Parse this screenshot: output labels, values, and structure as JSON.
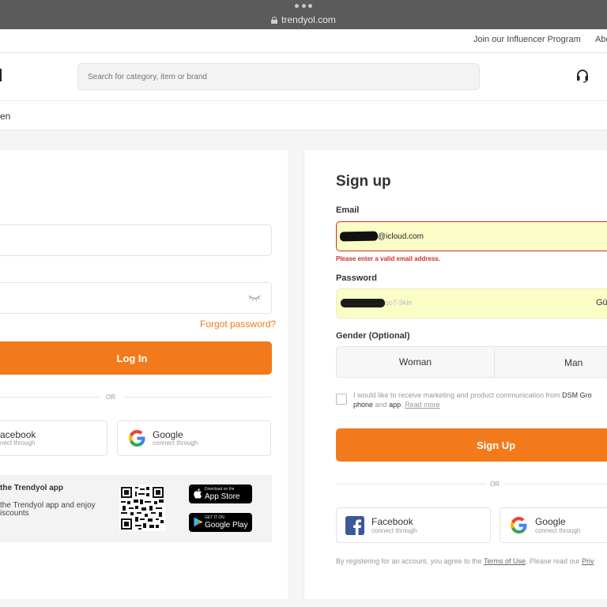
{
  "browser": {
    "url": "trendyol.com"
  },
  "top_links": {
    "influencer": "Join our Influencer Program",
    "about": "Abo"
  },
  "header": {
    "search_placeholder": "Search for category, item or brand"
  },
  "nav": {
    "partial_item": "en"
  },
  "login": {
    "forgot_password": "Forgot password?",
    "login_button": "Log In",
    "or": "OR",
    "facebook": {
      "name": "acebook",
      "sub": "nect through"
    },
    "google": {
      "name": "Google",
      "sub": "connect through"
    },
    "app": {
      "title": "the Trendyol app",
      "text_line1": "the Trendyol app and enjoy",
      "text_line2": "iscounts",
      "appstore_small": "Download on the",
      "appstore_big": "App Store",
      "playstore_small": "GET IT ON",
      "playstore_big": "Google Play"
    }
  },
  "signup": {
    "title": "Sign up",
    "email_label": "Email",
    "email_value": "@icloud.com",
    "email_error": "Please enter a valid email address.",
    "password_label": "Password",
    "password_value": "qoT-9kln",
    "password_suffix": "Gü",
    "gender_label": "Gender (Optional)",
    "gender_woman": "Woman",
    "gender_man": "Man",
    "consent_line1_a": "I would like to receive marketing and product communication from ",
    "consent_line1_b": "DSM Gro",
    "consent_line2_a": "phone",
    "consent_line2_b": " and ",
    "consent_line2_c": "app",
    "consent_line2_d": ". ",
    "consent_read_more": "Read more",
    "signup_button": "Sign Up",
    "or": "OR",
    "facebook": {
      "name": "Facebook",
      "sub": "connect through"
    },
    "google": {
      "name": "Google",
      "sub": "connect through"
    },
    "terms_a": "By registering for an account, you agree to the ",
    "terms_link": "Terms of Use",
    "terms_b": ". Please read our ",
    "privacy_link": "Priv"
  },
  "colors": {
    "accent": "#f27a1a",
    "error": "#d22c2c",
    "autofill": "#fbfdc7",
    "facebook": "#3b5998"
  }
}
